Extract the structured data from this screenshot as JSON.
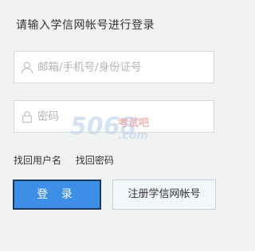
{
  "login": {
    "title": "请输入学信网帐号进行登录",
    "username": {
      "placeholder": "邮箱/手机号/身份证号",
      "value": "",
      "icon": "user-icon"
    },
    "password": {
      "placeholder": "密码",
      "value": "",
      "icon": "lock-icon"
    },
    "links": {
      "find_username": "找回用户名",
      "find_password": "找回密码"
    },
    "buttons": {
      "login": "登 录",
      "register": "注册学信网帐号"
    }
  },
  "watermark": {
    "brand": "考试吧",
    "domain": ".com",
    "number": "5068"
  },
  "colors": {
    "primary": "#3c8ee6",
    "login_border": "#1c3a5e",
    "background": "#f1f2f2"
  }
}
